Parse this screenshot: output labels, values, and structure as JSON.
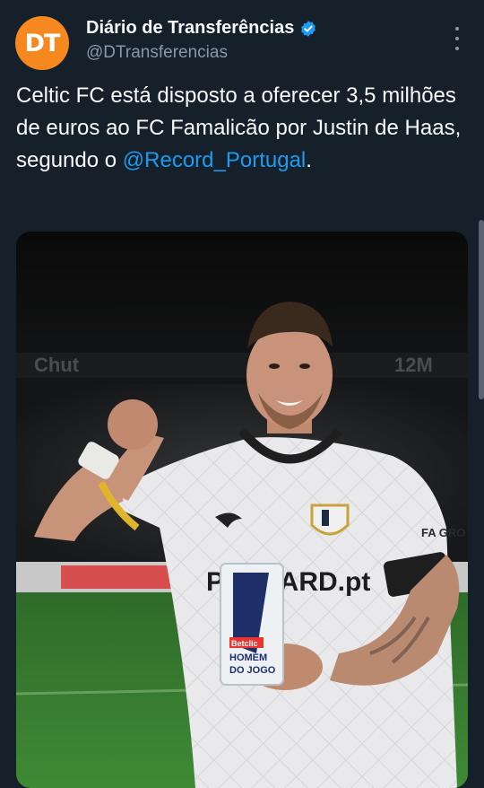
{
  "account": {
    "display_name": "Diário de Transferências",
    "handle": "@DTransferencias",
    "avatar_text": "DT",
    "avatar_color": "#f5891f",
    "verified": true
  },
  "tweet": {
    "text_before": "Celtic FC está disposto a oferecer 3,5 milhões de euros ao FC Famalicão por Justin de Haas, segundo o ",
    "mention": "@Record_Portugal",
    "text_after": "."
  },
  "media": {
    "sponsor_text": "PLACARD.pt",
    "trophy_brand": "Betclic",
    "trophy_text_1": "HOMEM",
    "trophy_text_2": "DO JOGO",
    "shirt_text": "FA GRO"
  },
  "colors": {
    "background": "#15202b",
    "link": "#1d9bf0",
    "secondary_text": "#8b98a5"
  },
  "icons": [
    "verified-badge-icon",
    "more-options-icon"
  ]
}
